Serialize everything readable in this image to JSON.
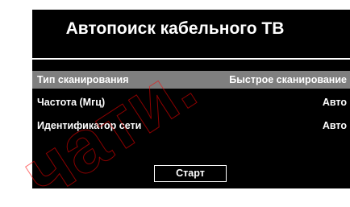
{
  "screen": {
    "title": "Автопоиск кабельного ТВ"
  },
  "settings": {
    "rows": [
      {
        "label": "Тип сканирования",
        "value": "Быстрое сканирование",
        "selected": true
      },
      {
        "label": "Частота (Мгц)",
        "value": "Авто",
        "selected": false
      },
      {
        "label": "Идентификатор сети",
        "value": "Авто",
        "selected": false
      }
    ]
  },
  "actions": {
    "start_label": "Старт"
  },
  "watermark": {
    "text": "чати.",
    "color": "#ff0000"
  },
  "colors": {
    "background": "#000000",
    "text": "#ffffff",
    "selected_row": "#7f7f7f"
  }
}
